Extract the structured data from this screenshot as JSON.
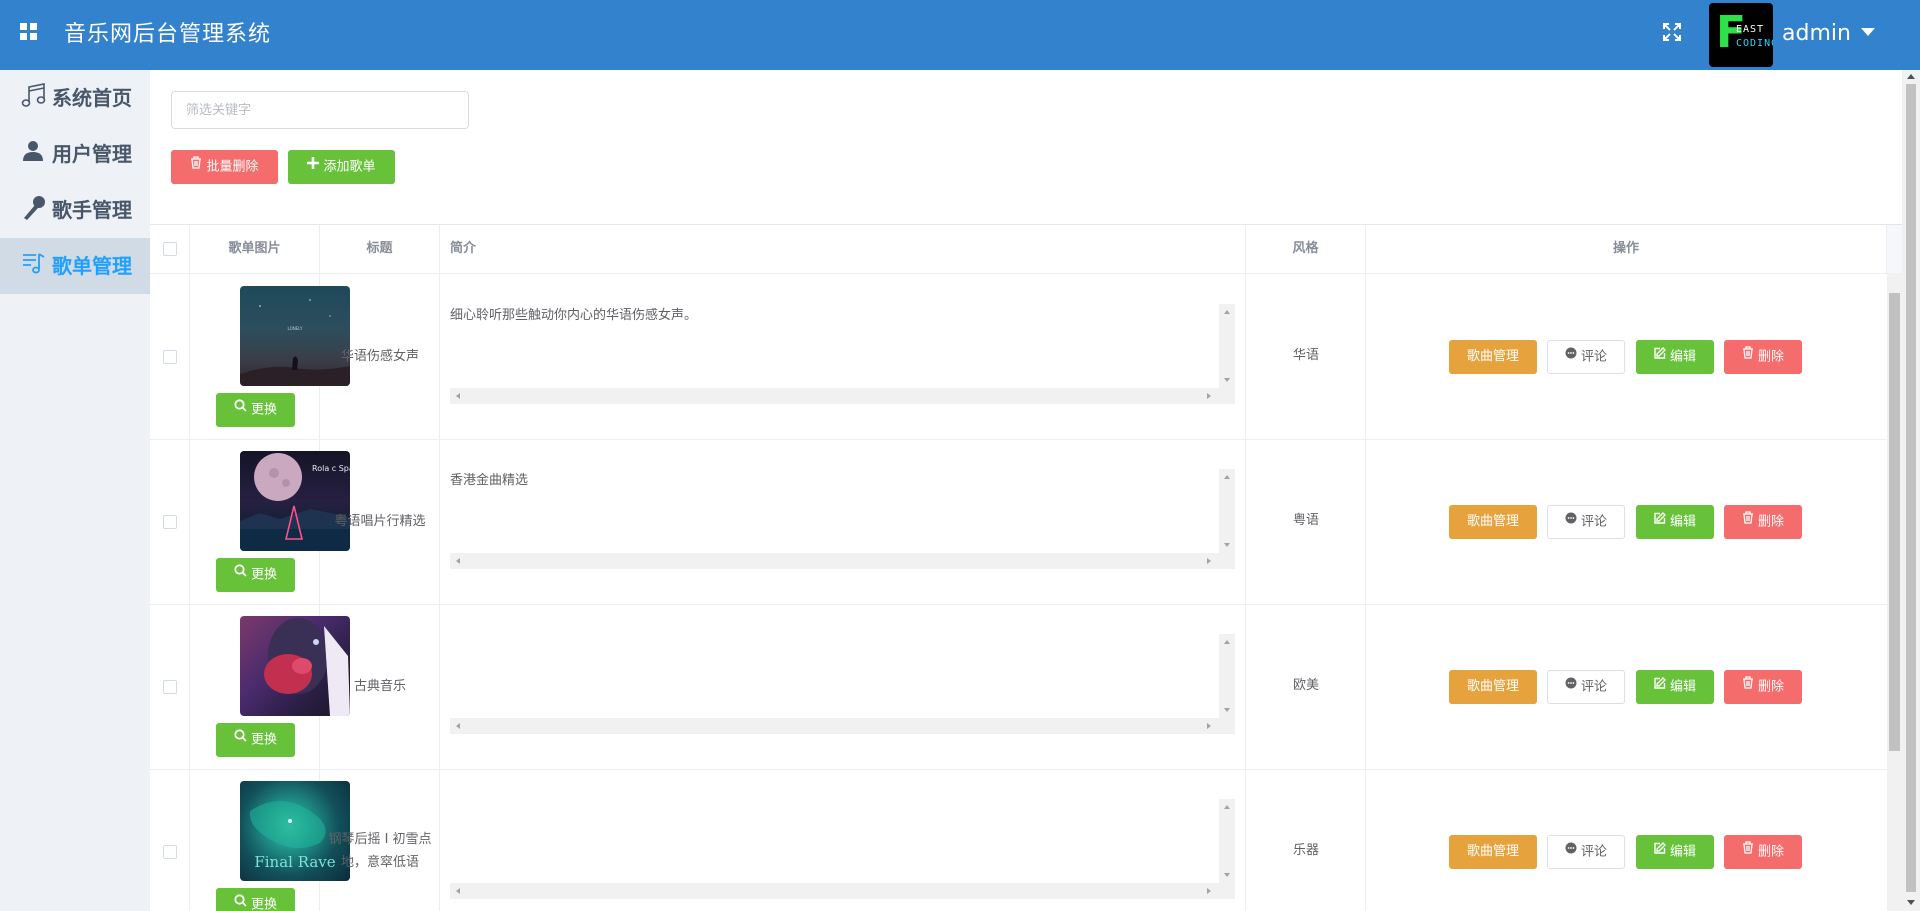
{
  "header": {
    "title": "音乐网后台管理系统",
    "avatar_text_top": "EAST",
    "avatar_text_bottom": "CODING",
    "avatar_letter": "F",
    "username": "admin"
  },
  "sidebar": {
    "items": [
      {
        "label": "系统首页",
        "icon": "music-note-icon",
        "active": false
      },
      {
        "label": "用户管理",
        "icon": "user-icon",
        "active": false
      },
      {
        "label": "歌手管理",
        "icon": "microphone-icon",
        "active": false
      },
      {
        "label": "歌单管理",
        "icon": "playlist-icon",
        "active": true
      }
    ]
  },
  "toolbar": {
    "filter_placeholder": "筛选关键字",
    "batch_delete_label": "批量删除",
    "add_playlist_label": "添加歌单"
  },
  "table": {
    "columns": [
      "歌单图片",
      "标题",
      "简介",
      "风格",
      "操作"
    ],
    "change_label": "更换",
    "actions": {
      "songs": "歌曲管理",
      "comment": "评论",
      "edit": "编辑",
      "delete": "删除"
    },
    "rows": [
      {
        "title": "华语伤感女声",
        "description": "细心聆听那些触动你内心的华语伤感女声。",
        "style": "华语"
      },
      {
        "title": "粤语唱片行精选",
        "description": "香港金曲精选",
        "style": "粤语",
        "cover_text": "Rola c Space"
      },
      {
        "title": "古典音乐",
        "description": "",
        "style": "欧美"
      },
      {
        "title": "钢琴后摇 I 初雪点地，意窣低语",
        "description": "",
        "style": "乐器",
        "cover_text": "Final Rave"
      }
    ]
  },
  "colors": {
    "header": "#3282cd",
    "success": "#67c23a",
    "danger": "#f56c6c",
    "warning": "#e6a23c",
    "active_text": "#20a0ff"
  }
}
